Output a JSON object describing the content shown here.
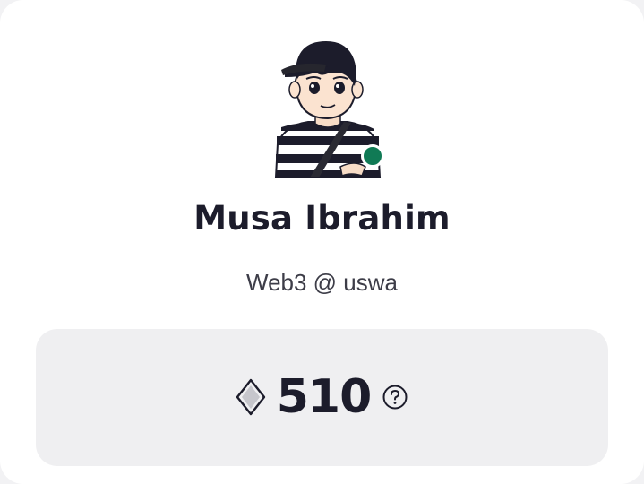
{
  "profile": {
    "name": "Musa Ibrahim",
    "role": "Web3 @ uswa",
    "status": "online",
    "status_color": "#107a55"
  },
  "points": {
    "value": "510",
    "icon": "diamond-icon",
    "help_icon": "question-circle-icon"
  },
  "colors": {
    "text_primary": "#1c1c2b",
    "text_secondary": "#3d3d48",
    "points_box_bg": "#efeff1"
  }
}
